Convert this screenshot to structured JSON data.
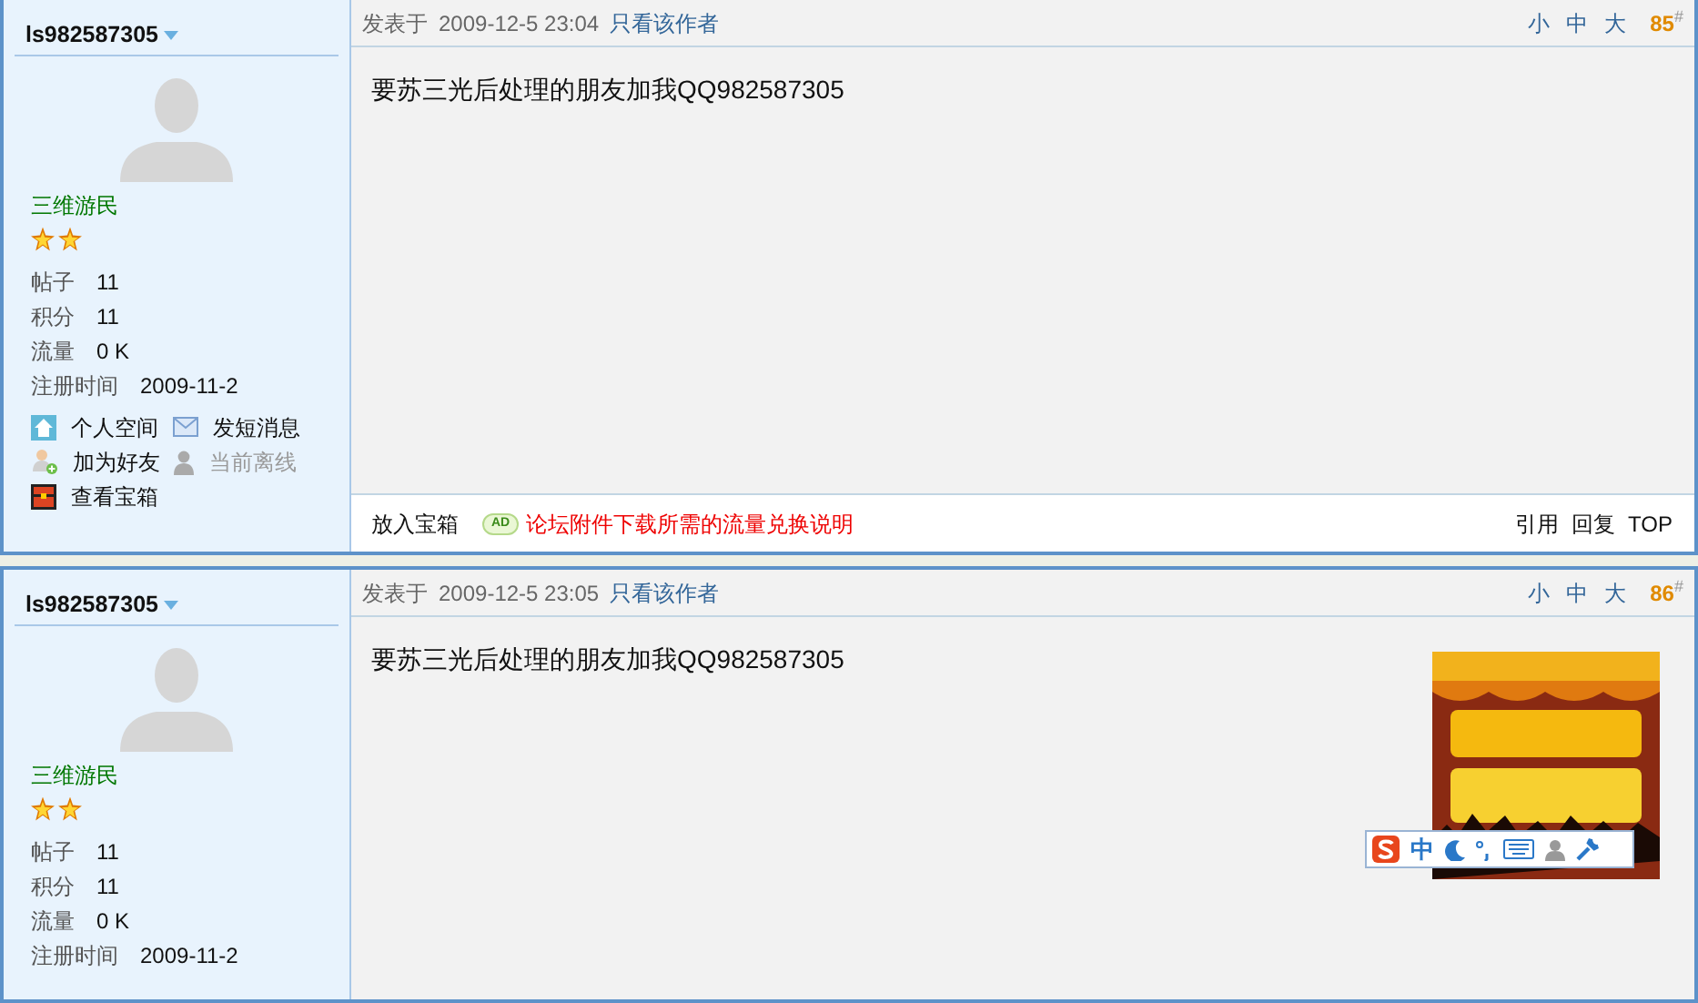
{
  "posts": [
    {
      "author": "ls982587305",
      "rank": "三维游民",
      "rank_icons": [
        {
          "kind": "star"
        },
        {
          "kind": "star"
        }
      ],
      "stats": [
        {
          "label": "帖子",
          "value": "11"
        },
        {
          "label": "积分",
          "value": "11"
        },
        {
          "label": "流量",
          "value": "0 K"
        },
        {
          "label": "注册时间",
          "value": "2009-11-2"
        }
      ],
      "actions": [
        {
          "kind": "home",
          "label": "个人空间",
          "disabled": false
        },
        {
          "kind": "mail",
          "label": "发短消息",
          "disabled": false
        },
        {
          "kind": "add-friend",
          "label": "加为好友",
          "disabled": false
        },
        {
          "kind": "offline",
          "label": "当前离线",
          "disabled": true
        },
        {
          "kind": "chest",
          "label": "查看宝箱",
          "disabled": false
        }
      ],
      "posted_label": "发表于",
      "time": "2009-12-5 23:04",
      "author_only": "只看该作者",
      "font_sizes": [
        "小",
        "中",
        "大"
      ],
      "floor": "85$^{#}$",
      "body": "要苏三光后处理的朋友加我QQ982587305",
      "footer": {
        "treasure": "放入宝箱",
        "ad_badge": "AD",
        "ad_link": "论坛附件下载所需的流量兑换说明",
        "links": [
          "引用",
          "回复",
          "TOP"
        ]
      }
    },
    {
      "author": "ls982587305",
      "rank": "三维游民",
      "rank_icons": [
        {
          "kind": "star"
        },
        {
          "kind": "star"
        }
      ],
      "stats": [
        {
          "label": "帖子",
          "value": "11"
        },
        {
          "label": "积分",
          "value": "11"
        },
        {
          "label": "流量",
          "value": "0 K"
        },
        {
          "label": "注册时间",
          "value": "2009-11-2"
        }
      ],
      "posted_label": "发表于",
      "time": "2009-12-5 23:05",
      "author_only": "只看该作者",
      "font_sizes": [
        "小",
        "中",
        "大"
      ],
      "floor": "86$^{#}$",
      "body": "要苏三光后处理的朋友加我QQ982587305",
      "ad_picture": {
        "kind": "picture"
      }
    }
  ],
  "ime_toolbar": {
    "mode": "中"
  }
}
